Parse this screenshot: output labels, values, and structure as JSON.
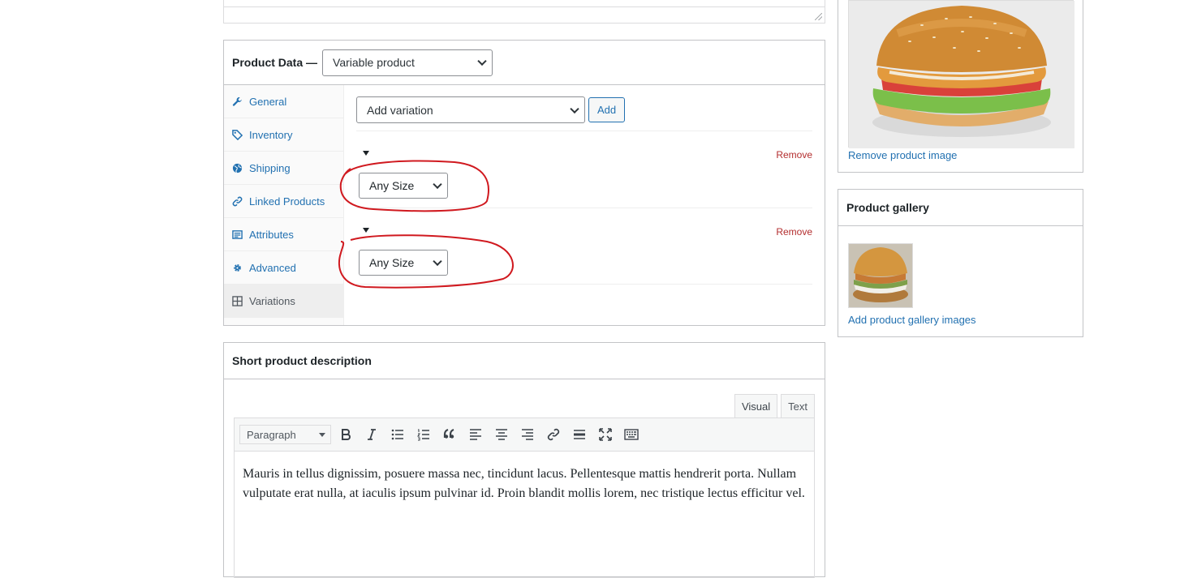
{
  "product_data": {
    "title": "Product Data —",
    "type_select": "Variable product",
    "tabs": [
      {
        "label": "General",
        "icon": "wrench-icon"
      },
      {
        "label": "Inventory",
        "icon": "tag-icon"
      },
      {
        "label": "Shipping",
        "icon": "globe-icon"
      },
      {
        "label": "Linked Products",
        "icon": "link-icon"
      },
      {
        "label": "Attributes",
        "icon": "list-icon"
      },
      {
        "label": "Advanced",
        "icon": "gear-icon"
      },
      {
        "label": "Variations",
        "icon": "grid-icon"
      }
    ],
    "active_tab": "Variations",
    "variation_select": "Add variation",
    "add_button": "Add",
    "variations": [
      {
        "size": "Any Size",
        "remove": "Remove"
      },
      {
        "size": "Any Size",
        "remove": "Remove"
      }
    ]
  },
  "short_description": {
    "title": "Short product description",
    "tab_visual": "Visual",
    "tab_text": "Text",
    "format": "Paragraph",
    "content": "Mauris in tellus dignissim, posuere massa nec, tincidunt lacus. Pellentesque mattis hendrerit porta. Nullam vulputate erat nulla, at iaculis ipsum pulvinar id. Proin blandit mollis lorem, nec tristique lectus efficitur vel."
  },
  "product_image": {
    "remove_link": "Remove product image"
  },
  "gallery": {
    "title": "Product gallery",
    "add_link": "Add product gallery images"
  },
  "colors": {
    "link": "#2271b1",
    "remove": "#b32d2e",
    "annotation": "#d0191f"
  }
}
